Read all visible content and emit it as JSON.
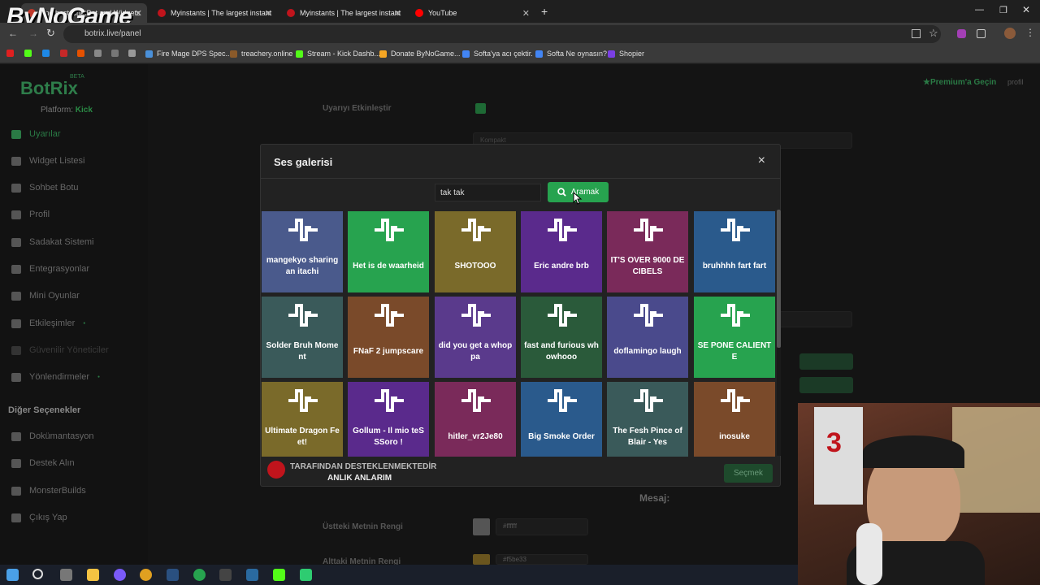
{
  "browser": {
    "tabs": [
      {
        "title": "The best ChatBot and Widgets",
        "color": "#c0392b"
      },
      {
        "title": "Myinstants | The largest instant",
        "color": "#c0141c"
      },
      {
        "title": "Myinstants | The largest instant",
        "color": "#c0141c"
      },
      {
        "title": "YouTube",
        "color": "#ff0000"
      }
    ],
    "url": "botrix.live/panel",
    "overlay_logo": "ByNoGame",
    "bookmarks": [
      "Fire Mage DPS Spec...",
      "treachery.online",
      "Stream - Kick Dashb...",
      "Donate ByNoGame...",
      "Softa'ya acı çektir.",
      "Softa Ne oynasın?",
      "Shopier"
    ]
  },
  "app": {
    "brand": "BotRix",
    "beta": "BETA",
    "platform_label": "Platform:",
    "platform_value": "Kick",
    "premium": "Premium'a Geçin",
    "profile": "profil",
    "nav": [
      {
        "label": "Uyarılar",
        "active": true
      },
      {
        "label": "Widget Listesi"
      },
      {
        "label": "Sohbet Botu"
      },
      {
        "label": "Profil"
      },
      {
        "label": "Sadakat Sistemi"
      },
      {
        "label": "Entegrasyonlar"
      },
      {
        "label": "Mini Oyunlar"
      },
      {
        "label": "Etkileşimler"
      },
      {
        "label": "Güvenilir Yöneticiler"
      },
      {
        "label": "Yönlendirmeler"
      }
    ],
    "other_options_title": "Diğer Seçenekler",
    "other_nav": [
      "Dokümantasyon",
      "Destek Alın",
      "MonsterBuilds",
      "Çıkış Yap"
    ],
    "bg_labels": {
      "enable_alert": "Uyarıyı Etkinleştir",
      "layout_value": "Kompakt",
      "message": "Mesaj:",
      "top_text_color": "Üstteki Metnin Rengi",
      "top_text_color_value": "#ffffff",
      "bottom_text_color": "Alttaki Metnin Rengi",
      "bottom_text_color_value": "#f5be33"
    }
  },
  "modal": {
    "title": "Ses galerisi",
    "close": "×",
    "search_value": "tak tak",
    "search_button": "Aramak",
    "sponsor_line1": "TARAFINDAN DESTEKLENMEKTEDİR",
    "sponsor_line2": "ANLIK ANLARIM",
    "select_button": "Seçmek",
    "sounds": [
      {
        "label": "mangekyo sharingan itachi",
        "color": "#4a5a8c"
      },
      {
        "label": "Het is de waarheid",
        "color": "#27a34f"
      },
      {
        "label": "SHOTOOO",
        "color": "#7a6a2a"
      },
      {
        "label": "Eric andre brb",
        "color": "#5a2a8c"
      },
      {
        "label": "IT'S OVER 9000 DECIBELS",
        "color": "#7a2a5a"
      },
      {
        "label": "bruhhhh fart fart",
        "color": "#2a5a8c"
      },
      {
        "label": "Solder Bruh Moment",
        "color": "#3a5a5a"
      },
      {
        "label": "FNaF 2 jumpscare",
        "color": "#7a4a2a"
      },
      {
        "label": "did you get a whoppa",
        "color": "#5a3a8c"
      },
      {
        "label": "fast and furious whowhooo",
        "color": "#2a5a3a"
      },
      {
        "label": "doflamingo laugh",
        "color": "#4a4a8c"
      },
      {
        "label": "SE PONE CALIENTE",
        "color": "#27a34f"
      },
      {
        "label": "Ultimate Dragon Feet!",
        "color": "#7a6a2a"
      },
      {
        "label": "Gollum - Il mio teSSSoro !",
        "color": "#5a2a8c"
      },
      {
        "label": "hitler_vr2Je80",
        "color": "#7a2a5a"
      },
      {
        "label": "Big Smoke Order",
        "color": "#2a5a8c"
      },
      {
        "label": "The Fesh Pince of Blair - Yes",
        "color": "#3a5a5a"
      },
      {
        "label": "inosuke",
        "color": "#7a4a2a"
      }
    ]
  }
}
